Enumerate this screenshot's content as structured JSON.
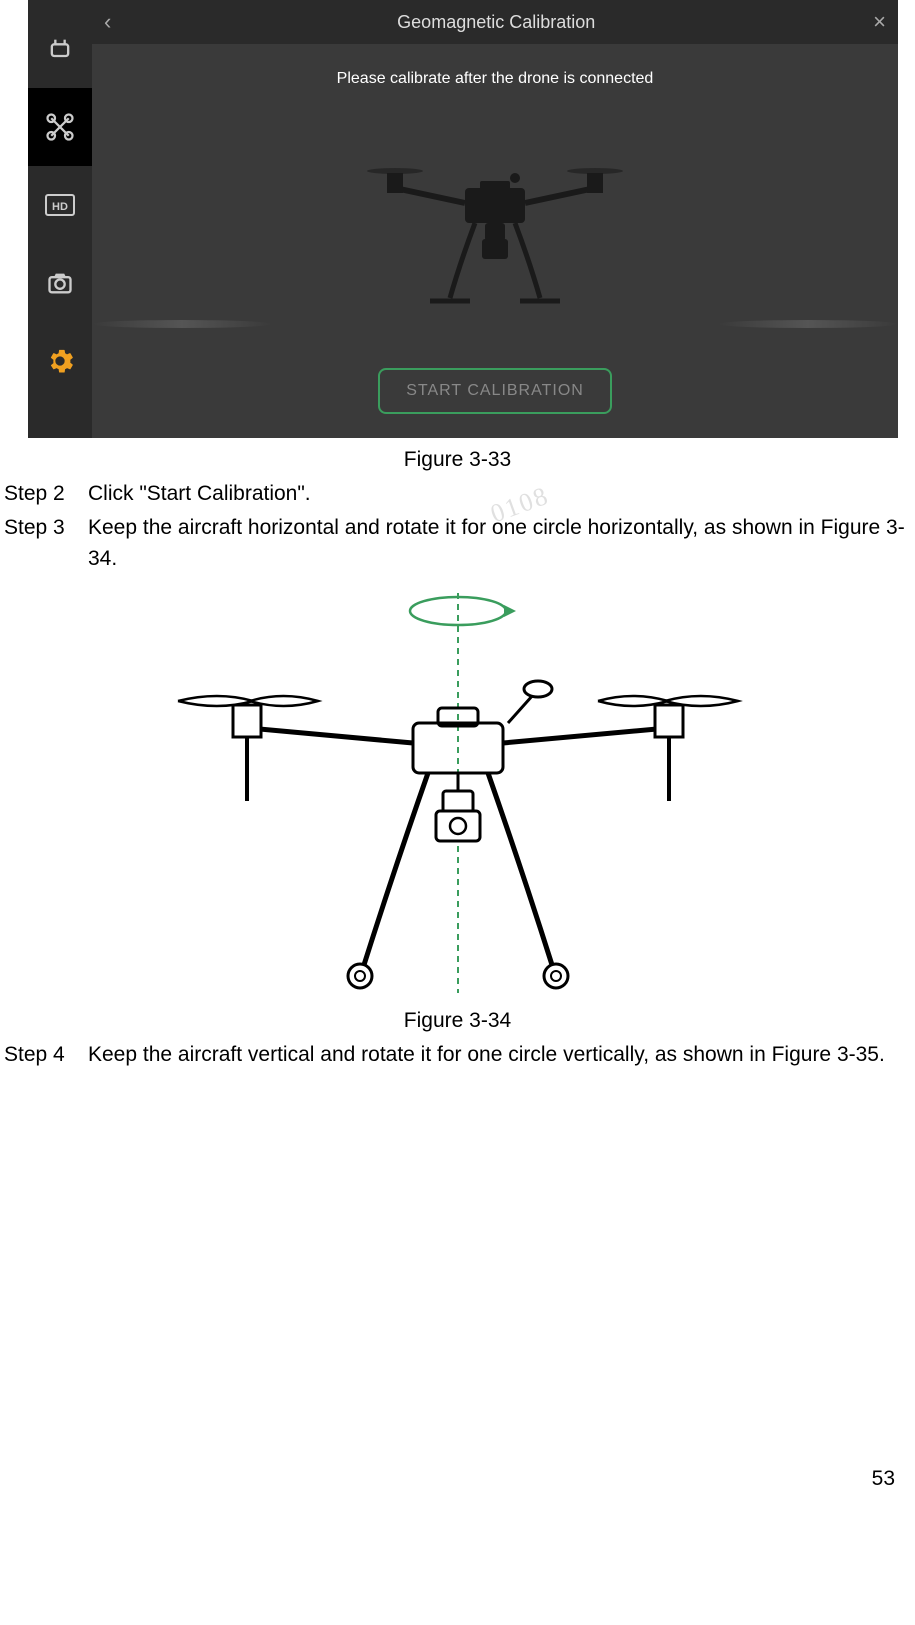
{
  "screenshot": {
    "header_title": "Geomagnetic Calibration",
    "message": "Please calibrate after the drone is connected",
    "button_label": "START CALIBRATION"
  },
  "captions": {
    "fig333": "Figure 3-33",
    "fig334": "Figure 3-34"
  },
  "steps": {
    "step2_label": "Step 2",
    "step2_text": "Click \"Start Calibration\".",
    "step3_label": "Step 3",
    "step3_text": "Keep the aircraft horizontal and rotate it for one circle horizontally, as shown in Figure 3-34.",
    "step4_label": "Step 4",
    "step4_text": "Keep the aircraft vertical and rotate it for one circle vertically, as shown in Figure 3-35."
  },
  "watermark": "0108",
  "page_number": "53"
}
